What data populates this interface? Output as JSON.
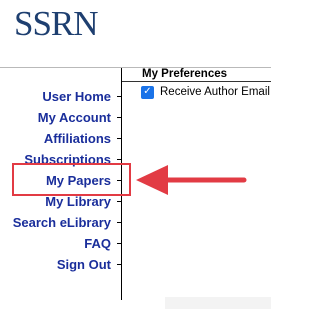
{
  "logo": {
    "text": "SSRN"
  },
  "panel": {
    "title": "My Preferences"
  },
  "preference": {
    "label": "Receive Author Email",
    "checked": true
  },
  "nav": {
    "items": [
      {
        "label": "User Home"
      },
      {
        "label": "My Account"
      },
      {
        "label": "Affiliations"
      },
      {
        "label": "Subscriptions"
      },
      {
        "label": "My Papers"
      },
      {
        "label": "My Library"
      },
      {
        "label": "Search eLibrary"
      },
      {
        "label": "FAQ"
      },
      {
        "label": "Sign Out"
      }
    ]
  },
  "annotation": {
    "color": "#e23b44",
    "highlighted_item": "My Papers"
  },
  "colors": {
    "brand": "#1e3f70",
    "link": "#1a2e9b",
    "checkbox": "#1a73e8"
  }
}
